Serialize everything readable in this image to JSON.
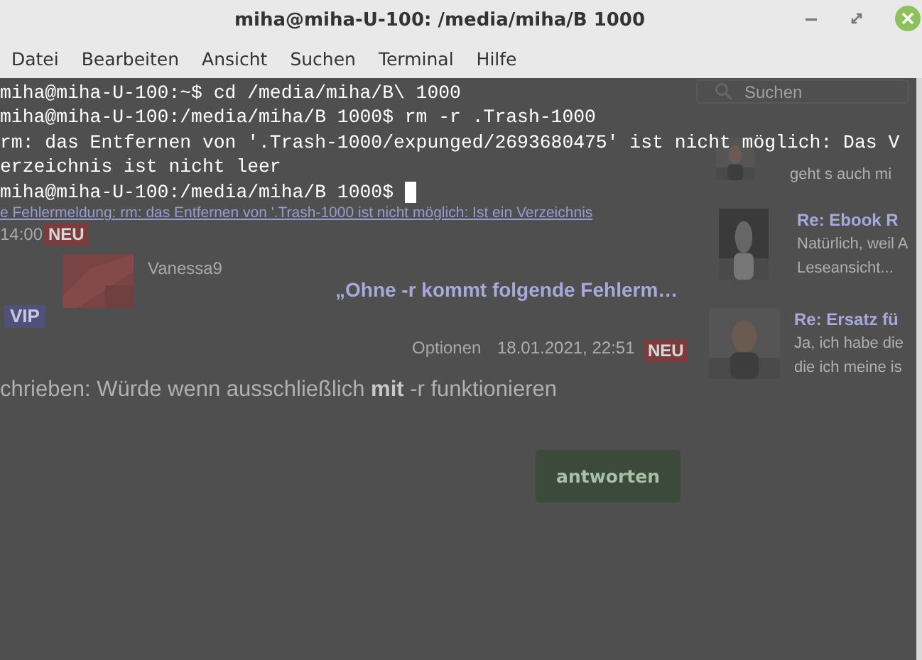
{
  "window": {
    "title": "miha@miha-U-100: /media/miha/B 1000"
  },
  "menu": [
    "Datei",
    "Bearbeiten",
    "Ansicht",
    "Suchen",
    "Terminal",
    "Hilfe"
  ],
  "terminal": {
    "lines": [
      "miha@miha-U-100:~$ cd /media/miha/B\\ 1000",
      "miha@miha-U-100:/media/miha/B 1000$ rm -r .Trash-1000",
      "rm: das Entfernen von '.Trash-1000/expunged/2693680475' ist nicht möglich: Das V",
      "erzeichnis ist nicht leer",
      "miha@miha-U-100:/media/miha/B 1000$ "
    ],
    "cursor": true
  },
  "background_page": {
    "search": {
      "placeholder": "Suchen"
    },
    "post": {
      "link": "e Fehlermeldung: rm: das Entfernen von '.Trash-1000 ist nicht möglich: Ist ein Verzeichnis",
      "time": "14:00",
      "badge": "NEU",
      "author": "Vanessa9",
      "quote": "„Ohne -r kommt folgende Fehlerm…",
      "rank": "VIP",
      "options": "Optionen",
      "date": "18.01.2021, 22:51",
      "date_badge": "NEU",
      "body": "chrieben: Würde wenn ausschließlich **mit** -r funktionieren",
      "reply": "antworten"
    },
    "sidebar": [
      {
        "snippet": [
          "geht s auch mi"
        ]
      },
      {
        "title": "Re: Ebook R",
        "snippet": [
          "Natürlich, weil A",
          "Leseansicht..."
        ]
      },
      {
        "title": "Re: Ersatz fü",
        "snippet": [
          "Ja, ich habe die",
          "die ich meine is"
        ]
      }
    ]
  }
}
